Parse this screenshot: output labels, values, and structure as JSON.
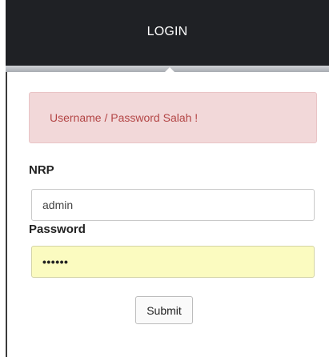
{
  "header": {
    "title": "LOGIN"
  },
  "alert": {
    "message": "Username / Password Salah !"
  },
  "form": {
    "nrp_label": "NRP",
    "nrp_value": "admin",
    "password_label": "Password",
    "password_value": "••••••",
    "submit_label": "Submit"
  },
  "colors": {
    "header_bg": "#1f2125",
    "alert_bg": "#f2d8d9",
    "alert_text": "#b34545",
    "password_autofill_bg": "#fbfbc0"
  }
}
